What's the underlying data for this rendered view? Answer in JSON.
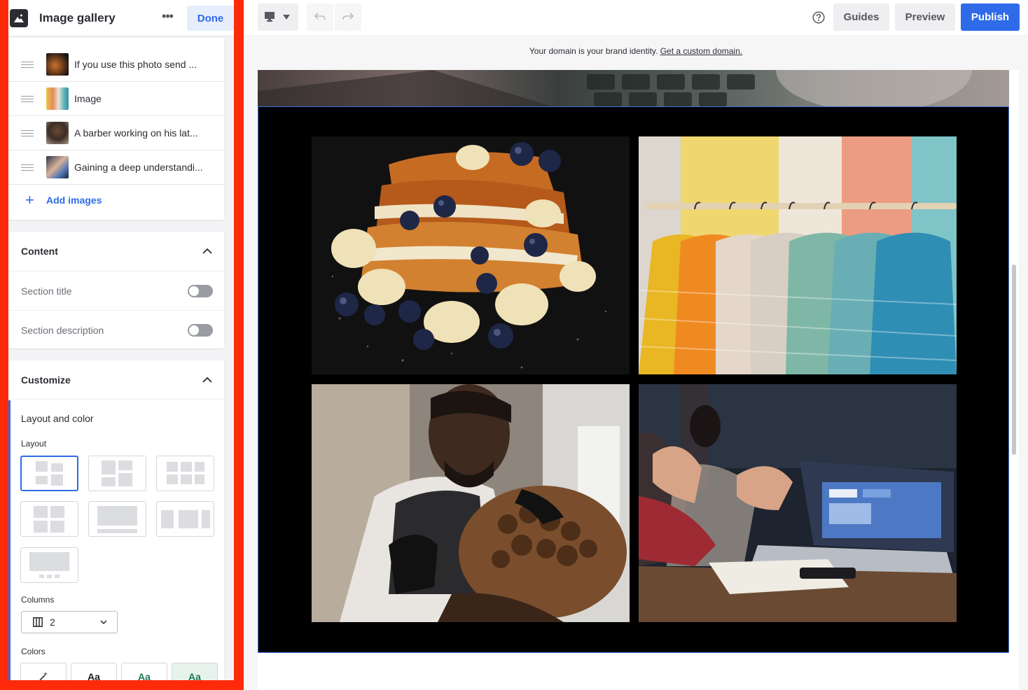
{
  "panel": {
    "title": "Image gallery",
    "done_label": "Done",
    "images": [
      {
        "label": "If you use this photo send ..."
      },
      {
        "label": "Image"
      },
      {
        "label": "A barber working on his lat..."
      },
      {
        "label": "Gaining a deep understandi..."
      }
    ],
    "add_images_label": "Add images",
    "content": {
      "title": "Content",
      "section_title_label": "Section title",
      "section_title_on": false,
      "section_description_label": "Section description",
      "section_description_on": false
    },
    "customize": {
      "title": "Customize",
      "layout_and_color_label": "Layout and color",
      "layout_label": "Layout",
      "columns_label": "Columns",
      "columns_value": "2",
      "colors_label": "Colors",
      "color_tiles": [
        {
          "text": "",
          "icon": "magic-wand-icon"
        },
        {
          "text": "Aa",
          "color": "#1f1f1f"
        },
        {
          "text": "Aa",
          "color": "#1e7a4f"
        },
        {
          "text": "Aa",
          "color": "#1e7a4f"
        }
      ]
    }
  },
  "toolbar": {
    "guides_label": "Guides",
    "preview_label": "Preview",
    "publish_label": "Publish"
  },
  "canvas": {
    "domain_text": "Your domain is your brand identity.",
    "domain_link": "Get a custom domain."
  },
  "colors": {
    "accent": "#2f6be8",
    "highlight_frame": "#ff2a0a",
    "gallery_bg": "#000000"
  }
}
